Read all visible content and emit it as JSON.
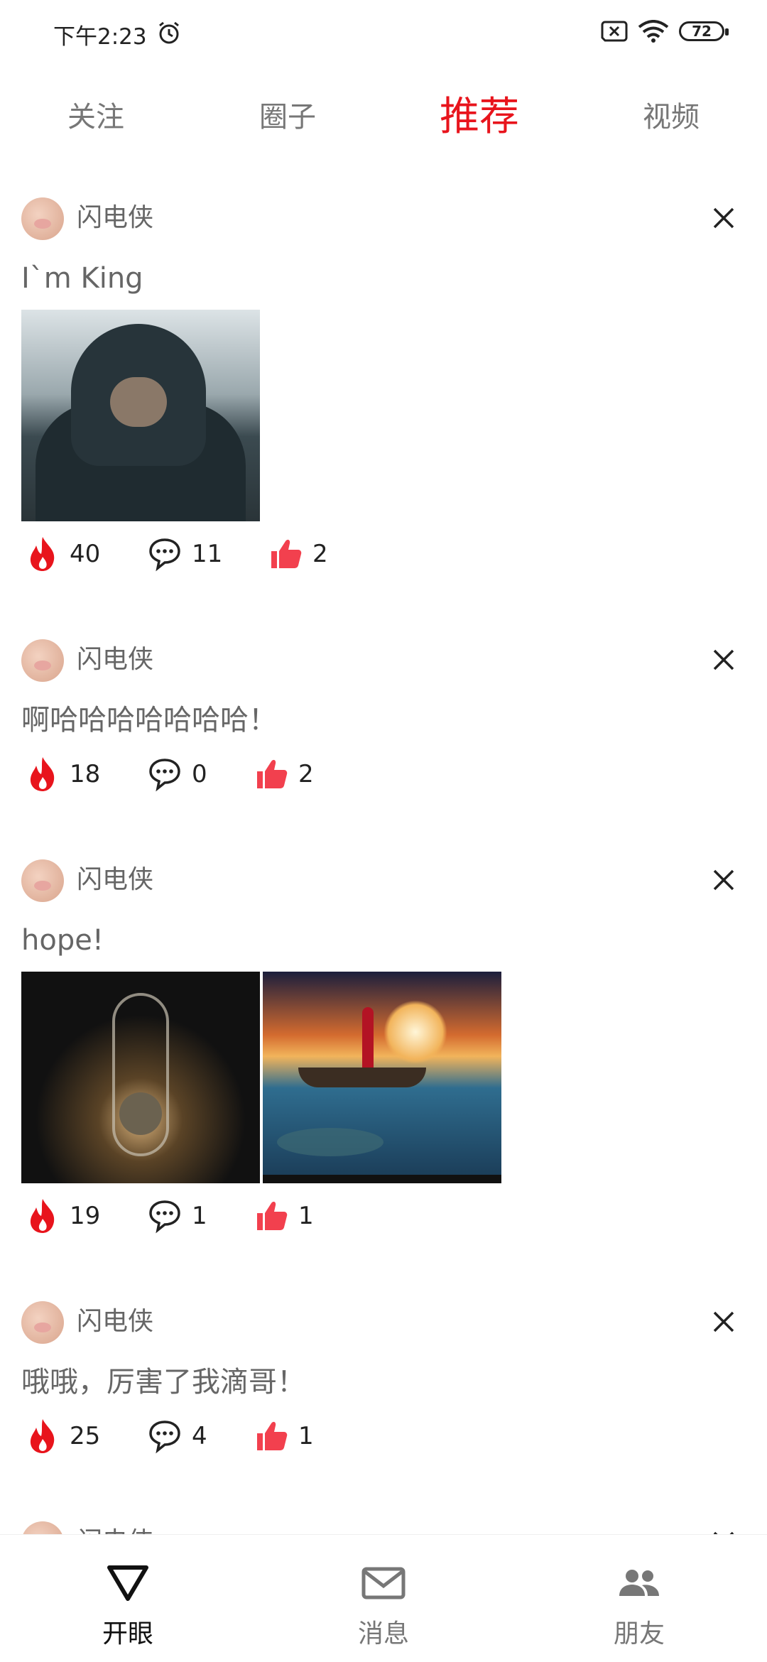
{
  "status_bar": {
    "time": "下午2:23",
    "battery": "72"
  },
  "top_tabs": [
    {
      "label": "关注",
      "active": false
    },
    {
      "label": "圈子",
      "active": false
    },
    {
      "label": "推荐",
      "active": true
    },
    {
      "label": "视频",
      "active": false
    }
  ],
  "posts": [
    {
      "author": "闪电侠",
      "text": "I`m King",
      "heat": "40",
      "comments": "11",
      "likes": "2"
    },
    {
      "author": "闪电侠",
      "text": "啊哈哈哈哈哈哈哈！",
      "heat": "18",
      "comments": "0",
      "likes": "2"
    },
    {
      "author": "闪电侠",
      "text": "hope!",
      "heat": "19",
      "comments": "1",
      "likes": "1"
    },
    {
      "author": "闪电侠",
      "text": "哦哦，厉害了我滴哥！",
      "heat": "25",
      "comments": "4",
      "likes": "1"
    },
    {
      "author": "闪电侠",
      "text": "",
      "heat": "",
      "comments": "",
      "likes": ""
    }
  ],
  "bottom_nav": [
    {
      "label": "开眼",
      "active": true
    },
    {
      "label": "消息",
      "active": false
    },
    {
      "label": "朋友",
      "active": false
    }
  ],
  "colors": {
    "accent": "#e8141c",
    "heat": "#e8141c",
    "like": "#f2404e"
  }
}
